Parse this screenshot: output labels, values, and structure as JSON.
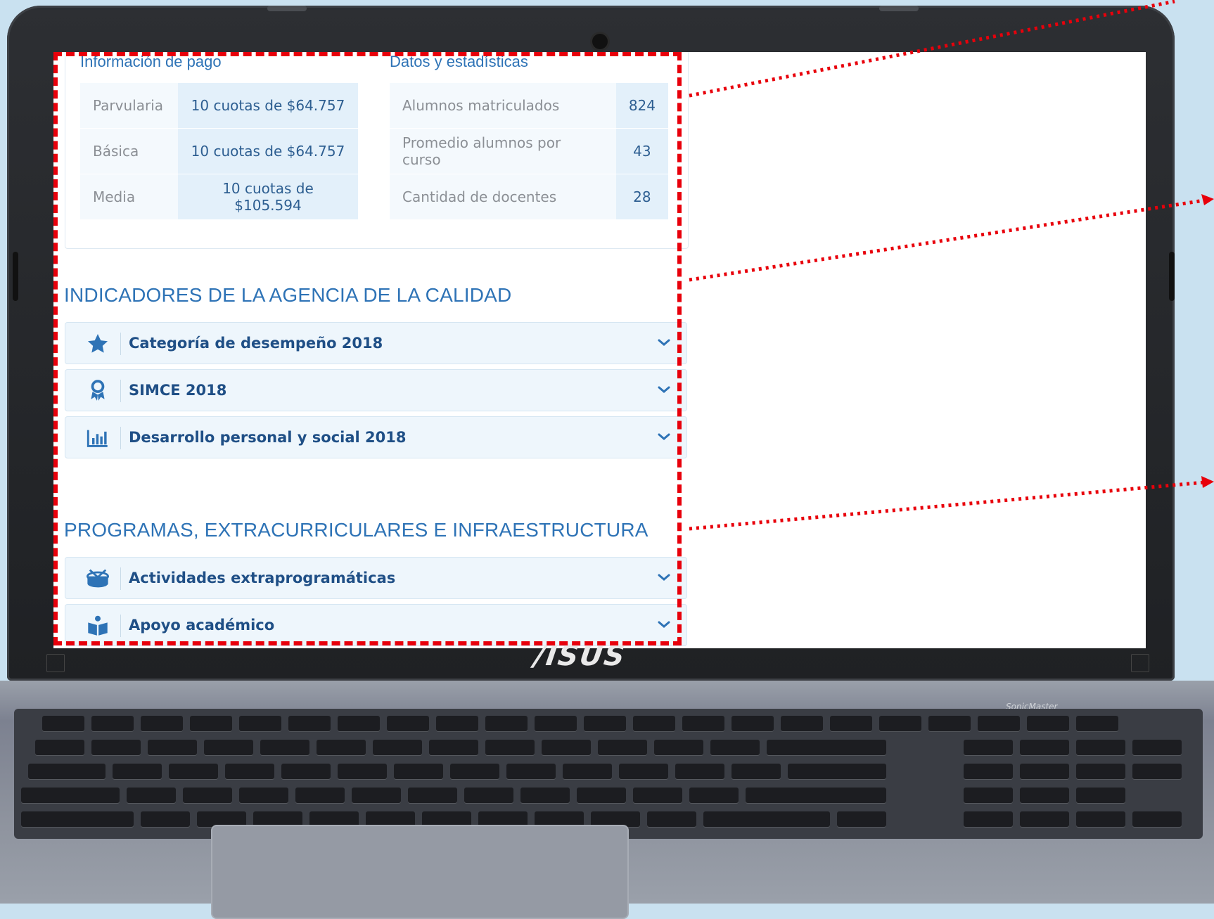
{
  "payment": {
    "title": "Información de pago",
    "rows": [
      {
        "level": "Parvularia",
        "amount": "10 cuotas de $64.757"
      },
      {
        "level": "Básica",
        "amount": "10 cuotas de $64.757"
      },
      {
        "level": "Media",
        "amount": "10 cuotas de $105.594"
      }
    ]
  },
  "stats": {
    "title": "Datos y estadísticas",
    "rows": [
      {
        "label": "Alumnos matriculados",
        "value": "824"
      },
      {
        "label": "Promedio alumnos por curso",
        "value": "43"
      },
      {
        "label": "Cantidad de docentes",
        "value": "28"
      }
    ]
  },
  "quality_section": {
    "title": "INDICADORES DE LA AGENCIA DE LA CALIDAD",
    "items": [
      {
        "label": "Categoría de desempeño 2018",
        "icon": "star-icon"
      },
      {
        "label": "SIMCE 2018",
        "icon": "award-ribbon-icon"
      },
      {
        "label": "Desarrollo personal y social 2018",
        "icon": "bar-chart-icon"
      }
    ]
  },
  "programs_section": {
    "title": "PROGRAMAS, EXTRACURRICULARES E INFRAESTRUCTURA",
    "items": [
      {
        "label": "Actividades extraprogramáticas",
        "icon": "drum-icon"
      },
      {
        "label": "Apoyo académico",
        "icon": "reading-person-icon"
      }
    ]
  },
  "brand": {
    "logo_text": "/ISUS",
    "audio_text": "SonicMaster"
  },
  "colors": {
    "accent": "#2e73b6",
    "highlight": "#e8000b",
    "row_bg": "#eef6fc"
  }
}
